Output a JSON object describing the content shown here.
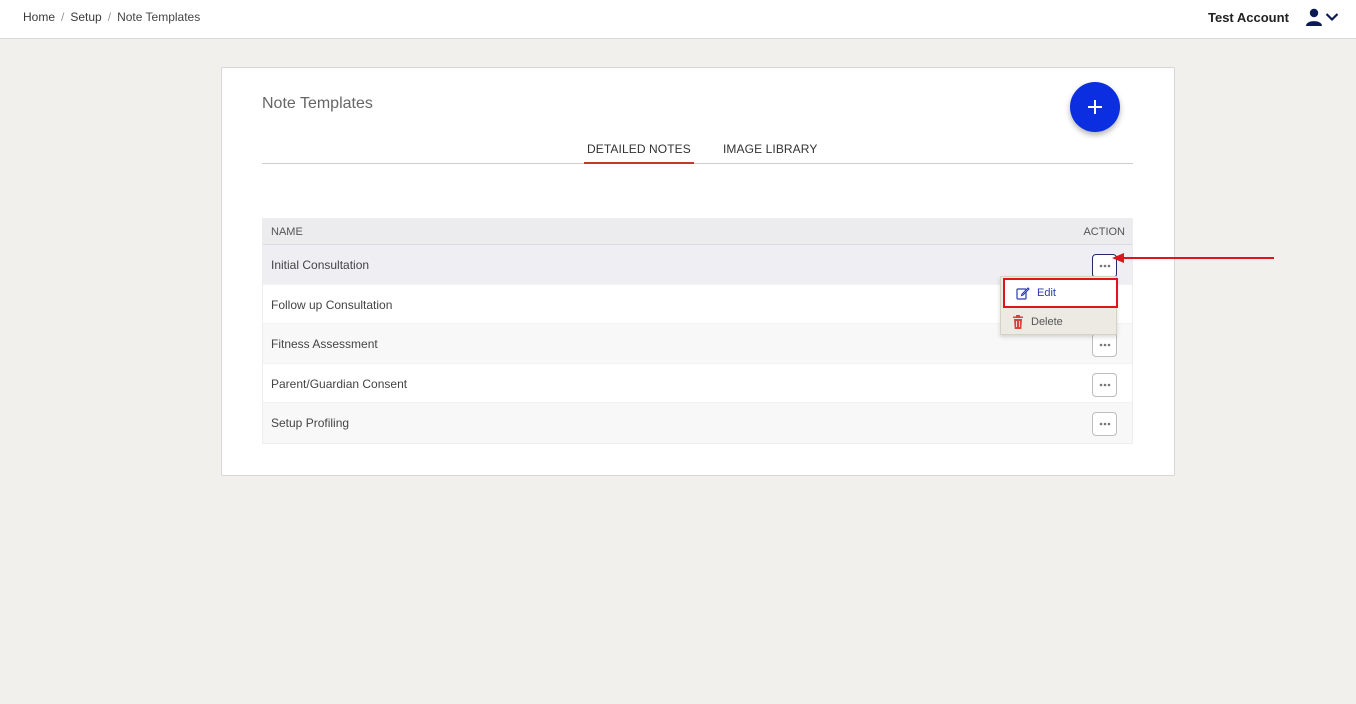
{
  "breadcrumb": {
    "items": [
      "Home",
      "Setup",
      "Note Templates"
    ],
    "separator": "/"
  },
  "header": {
    "account_name": "Test Account",
    "user_icon": "user-icon",
    "chevron_icon": "chevron-down-icon"
  },
  "page": {
    "title": "Note Templates",
    "add_button_icon": "plus-icon"
  },
  "tabs": [
    {
      "label": "DETAILED NOTES",
      "active": true
    },
    {
      "label": "IMAGE LIBRARY",
      "active": false
    }
  ],
  "table": {
    "columns": [
      "NAME",
      "ACTION"
    ],
    "rows": [
      {
        "name": "Initial Consultation"
      },
      {
        "name": "Follow up Consultation"
      },
      {
        "name": "Fitness Assessment"
      },
      {
        "name": "Parent/Guardian Consent"
      },
      {
        "name": "Setup Profiling"
      }
    ]
  },
  "action_menu": {
    "items": [
      {
        "label": "Edit",
        "icon": "edit-icon"
      },
      {
        "label": "Delete",
        "icon": "trash-icon"
      }
    ]
  },
  "colors": {
    "accent": "#0a2ee0",
    "tab_underline": "#c0392b",
    "annotation": "#e0141b",
    "background": "#f1f0ec"
  }
}
